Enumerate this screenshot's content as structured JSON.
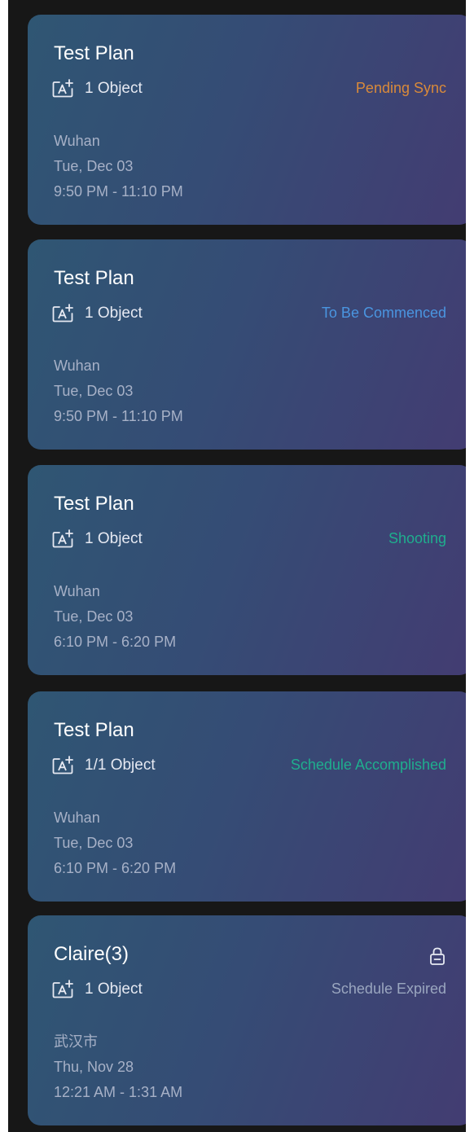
{
  "colors": {
    "pending": "#d98a3a",
    "commenced": "#4a95e0",
    "shooting": "#1fae8e",
    "accomplished": "#1fae8e",
    "expired": "#9aa6bf"
  },
  "cards": [
    {
      "title": "Test Plan",
      "object_count": "1 Object",
      "status": "Pending Sync",
      "status_color": "#d98a3a",
      "location": "Wuhan",
      "date": "Tue, Dec 03",
      "time": "9:50 PM - 11:10 PM",
      "locked": false
    },
    {
      "title": "Test Plan",
      "object_count": "1 Object",
      "status": "To Be Commenced",
      "status_color": "#4a95e0",
      "location": "Wuhan",
      "date": "Tue, Dec 03",
      "time": "9:50 PM - 11:10 PM",
      "locked": false
    },
    {
      "title": "Test Plan",
      "object_count": "1 Object",
      "status": "Shooting",
      "status_color": "#1fae8e",
      "location": "Wuhan",
      "date": "Tue, Dec 03",
      "time": "6:10 PM - 6:20 PM",
      "locked": false
    },
    {
      "title": "Test Plan",
      "object_count": "1/1 Object",
      "status": "Schedule Accomplished",
      "status_color": "#1fae8e",
      "location": "Wuhan",
      "date": "Tue, Dec 03",
      "time": "6:10 PM - 6:20 PM",
      "locked": false
    },
    {
      "title": "Claire(3)",
      "object_count": "1 Object",
      "status": "Schedule Expired",
      "status_color": "#9aa6bf",
      "location": "武汉市",
      "date": "Thu, Nov 28",
      "time": "12:21 AM - 1:31 AM",
      "locked": true,
      "lock_icon": "lock-icon"
    }
  ]
}
